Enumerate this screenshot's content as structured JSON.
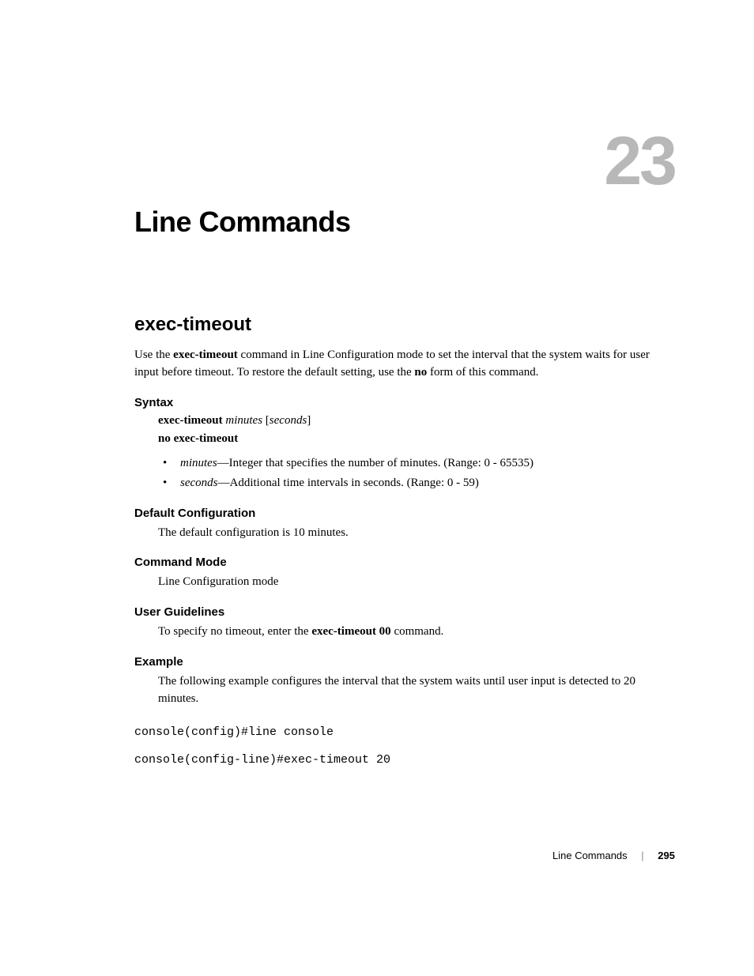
{
  "chapter": {
    "number": "23",
    "title": "Line Commands"
  },
  "section": {
    "title": "exec-timeout",
    "intro_parts": {
      "p1": "Use the ",
      "p2": "exec-timeout",
      "p3": " command in Line Configuration mode to set the interval that the system waits for user input before timeout. To restore the default setting, use the ",
      "p4": "no",
      "p5": " form of this command."
    }
  },
  "syntax": {
    "heading": "Syntax",
    "line1": {
      "cmd": "exec-timeout",
      "arg1": "minutes",
      "bracket_open": " [",
      "arg2": "seconds",
      "bracket_close": "]"
    },
    "line2": "no exec-timeout",
    "bullets": [
      {
        "term": "minutes",
        "desc": "—Integer that specifies the number of minutes. (Range: 0 - 65535)"
      },
      {
        "term": "seconds",
        "desc": "—Additional time intervals in seconds. (Range: 0 - 59)"
      }
    ]
  },
  "default_config": {
    "heading": "Default Configuration",
    "text": "The default configuration is 10 minutes."
  },
  "command_mode": {
    "heading": "Command Mode",
    "text": "Line Configuration mode"
  },
  "user_guidelines": {
    "heading": "User Guidelines",
    "parts": {
      "p1": "To specify no timeout, enter the ",
      "p2": "exec-timeout 00",
      "p3": " command."
    }
  },
  "example": {
    "heading": "Example",
    "text": "The following example configures the interval that the system waits until user input is detected to 20 minutes.",
    "code": [
      "console(config)#line console",
      "console(config-line)#exec-timeout 20"
    ]
  },
  "footer": {
    "section": "Line Commands",
    "page": "295"
  }
}
